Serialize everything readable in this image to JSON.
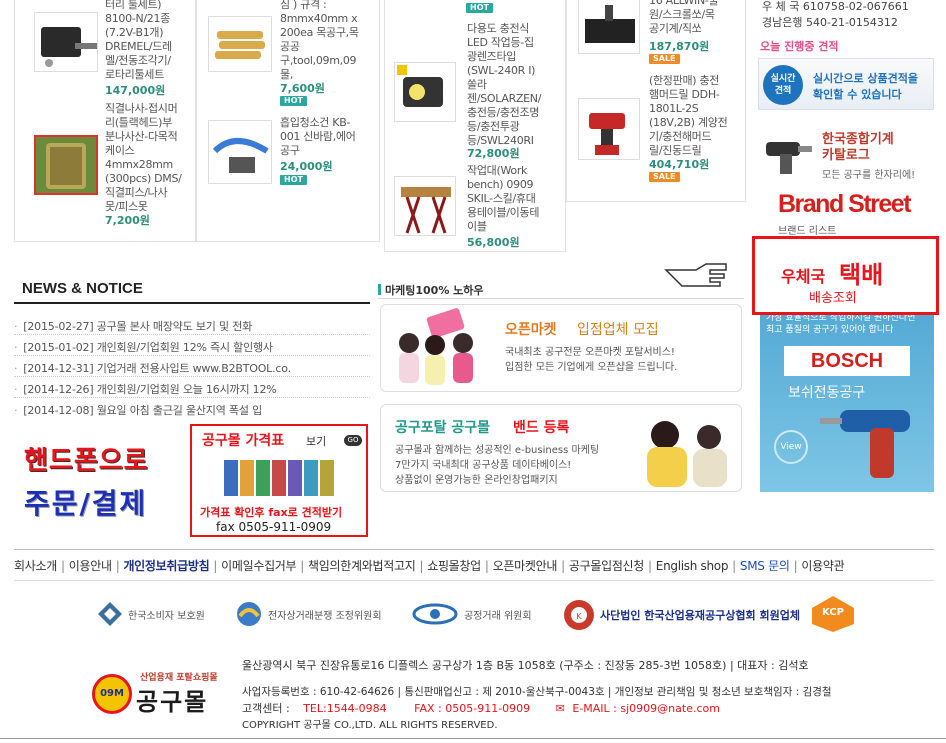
{
  "products": {
    "col1": [
      {
        "name": "터리 툴세트)\n8100-N/21종\n(7.2V-B1개)\nDREMEL/드레\n멜/전동조각기/\n로타리툴세트",
        "price": "147,000원"
      },
      {
        "name": "직결나사-접시머\n리(틀랙헤드)부\n분나사산-다목적\n케이스\n4mmx28mm\n(300pcs) DMS/\n직결피스/나사\n못/피스못",
        "price": "7,200원"
      }
    ],
    "col2": [
      {
        "name": "심 ) 규격 :\n8mmx40mm x\n200ea 목공구,목\n공공\n구,tool,09m,09\n물,",
        "price": "7,600원",
        "tag": "HOT"
      },
      {
        "name": "흡입청소건 KB-\n001 신바람,에어\n공구",
        "price": "24,000원",
        "tag": "HOT"
      }
    ],
    "col3": [
      {
        "name": "다용도 충전식\nLED 작업등-집\n광렌즈타입\n(SWL-240R I)\n쏠라\n젠/SOLARZEN/\n충전등/충전조명\n등/충전투광\n등/SWL240RI",
        "price": "72,800원",
        "tag": "HOT"
      },
      {
        "name": "작업대(Work\nbench) 0909\nSKIL-스킬/휴대\n용테이블/이동테\n이블",
        "price": "56,800원"
      }
    ],
    "col4": [
      {
        "name": "16 ALLWIN-줄\n원/스크롤쏘/목\n공기계/직쏘",
        "price": "187,870원",
        "tag": "SALE"
      },
      {
        "name": "(한정판매) 충전\n햄머드릴 DDH-\n1801L-2S\n(18V,2B) 계양전\n기/충전해머드\n릴/진동드릴",
        "price": "404,710원",
        "tag": "SALE"
      }
    ]
  },
  "sidebar": {
    "account_line1": "우 체 국 610758-02-067661",
    "account_line2": "경남은행 540-21-0154312",
    "today_quote": "오늘 진행중 견적",
    "realtime_badge": "실시간\n견적",
    "realtime_text": "실시간으로 상품견적을\n확인할 수 있습니다",
    "catalog_title": "한국종합기계\n카탈로그",
    "catalog_sub": "모든 공구를 한자리에!",
    "brand_title": "Brand Street",
    "brand_sub": "브랜드 리스트",
    "parcel_title1": "우체국",
    "parcel_title2": "택배",
    "parcel_sub": "배송조회",
    "bosch_top": "가장 효율적으로 작업하시길 원하신다면\n최고 품질의 공구가 있어야 합니다",
    "bosch_logo": "BOSCH",
    "bosch_text": "보쉬전동공구",
    "bosch_view": "View"
  },
  "notice": {
    "title": "NEWS & NOTICE",
    "items": [
      "[2015-02-27] 공구몰 본사 매장약도 보기 및 전화",
      "[2015-01-02] 개인회원/기업회원 12% 즉시 할인행사",
      "[2014-12-31] 기업거래 전용사입트 www.B2BTOOL.co.",
      "[2014-12-26] 개인회원/기업회원 오늘 16시까지 12%",
      "[2014-12-08] 월요일 아침 출근길 울산지역 폭설 입"
    ]
  },
  "marketing": {
    "title": "마케팅100% 노하우",
    "openmarket_title1": "오픈마켓",
    "openmarket_title2": "입점업체 모집",
    "openmarket_desc": "국내최초 공구전문 오픈마켓 포탈서비스!\n입점한 모든 기업에게 오픈샵을 드립니다.",
    "band_title1": "공구포탈 공구몰",
    "band_title2": "밴드 등록",
    "band_desc": "공구몰과 함께하는 성공적인 e-business 마케팅\n7만가지 국내최대 공구상품 데이타베이스!\n상품없이 운영가능한 온라인창업패키지"
  },
  "mobile_banner": {
    "line1": "핸드폰으로",
    "line2": "주문/결제"
  },
  "price_banner": {
    "title": "공구몰 가격표",
    "title_suffix": "보기",
    "go": "GO",
    "line1": "가격표 확인후 fax로 견적받기",
    "line2": "fax 0505-911-0909"
  },
  "footer_links": [
    "회사소개",
    "이용안내",
    "개인정보취급방침",
    "이메일수집거부",
    "책임의한계와법적고지",
    "쇼핑몰창업",
    "오픈마켓안내",
    "공구몰입점신청",
    "English shop",
    "SMS 문의",
    "이용약관"
  ],
  "orgs": [
    {
      "name": "한국소비자 보호원",
      "icon": "consumer-icon"
    },
    {
      "name": "전자상거래분쟁 조정위원회",
      "icon": "dispute-icon"
    },
    {
      "name": "공정거래 위원회",
      "icon": "ftc-icon"
    },
    {
      "name": "사단법인 한국산업용재공구상협회 회원업체",
      "icon": "association-icon"
    },
    {
      "name": "KCP",
      "icon": "kcp-icon"
    }
  ],
  "company": {
    "logo_top": "산업용재 포탈쇼핑몰",
    "logo_badge": "09M",
    "logo_name": "공구몰",
    "address": "울산광역시 북구 진장유통로16  디플렉스 공구상가 1층 B동 1058호 (구주소 : 진장동 285-3번  1058호) | 대표자 : 김석호",
    "biz": "사업자등록번호 : 610-42-64626  |  통신판매업신고 : 제 2010-울산북구-0043호  |   개인정보 관리책임 및 청소년 보호책임자 : 김경철",
    "cs_label": "고객센터 :",
    "tel": "TEL:1544-0984",
    "fax": "FAX : 0505-911-0909",
    "email": "E-MAIL : sj0909@nate.com",
    "copyright": "COPYRIGHT 공구몰 CO.,LTD.  ALL RIGHTS RESERVED."
  },
  "colors": {
    "accent_green": "#2b8f7a",
    "hot": "#2aa8a0",
    "sale": "#f08a24",
    "red": "#e8141a",
    "pink": "#e94d8a",
    "bosch_bg": "#5fb3d8"
  }
}
